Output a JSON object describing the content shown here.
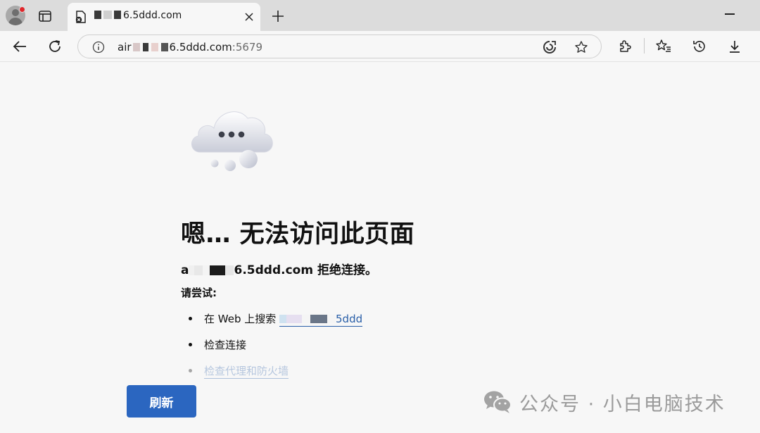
{
  "browser": {
    "tab": {
      "title_suffix": "6.5ddd.com"
    },
    "addressbar": {
      "host_prefix": "air",
      "host_suffix": "6.5ddd.com",
      "port": ":5679"
    }
  },
  "error_page": {
    "heading": "嗯… 无法访问此页面",
    "refused_host_prefix": "a",
    "refused_host_suffix": "6.5ddd.com",
    "refused_text": " 拒绝连接。",
    "try_label": "请尝试:",
    "suggestions": [
      {
        "prefix": "在 Web 上搜索 ",
        "link": "5ddd"
      },
      {
        "text": "检查连接"
      },
      {
        "link": "检查代理和防火墙"
      }
    ],
    "refresh_label": "刷新"
  },
  "watermark": {
    "text": "公众号 · 小白电脑技术"
  },
  "colors": {
    "accent": "#2b66c0",
    "link": "#2a5fa8",
    "background": "#f7f7f7",
    "tabstrip": "#dcdcdc"
  },
  "icons": [
    "profile-avatar-icon",
    "tab-actions-icon",
    "blocked-page-favicon",
    "close-icon",
    "plus-icon",
    "minimize-icon",
    "back-arrow-icon",
    "refresh-icon",
    "info-icon",
    "translate-icon",
    "favorite-star-icon",
    "extensions-icon",
    "favorites-icon",
    "history-icon",
    "download-icon",
    "cloud-icon",
    "wechat-icon"
  ]
}
